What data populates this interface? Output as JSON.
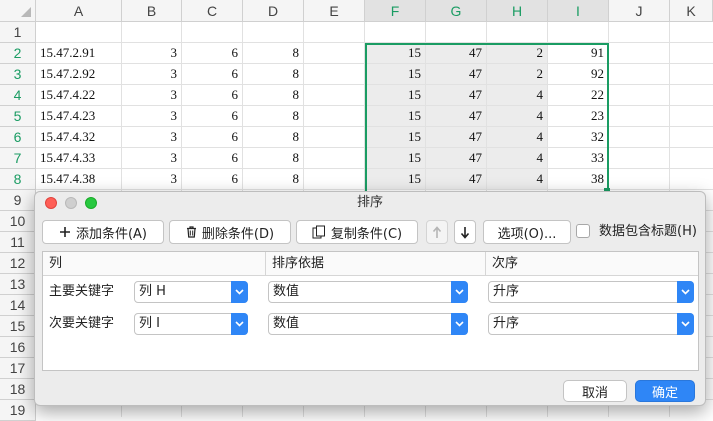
{
  "sheet": {
    "columns": [
      "A",
      "B",
      "C",
      "D",
      "E",
      "F",
      "G",
      "H",
      "I",
      "J",
      "K"
    ],
    "rows": [
      "1",
      "2",
      "3",
      "4",
      "5",
      "6",
      "7",
      "8",
      "9",
      "10",
      "11",
      "12",
      "13",
      "14",
      "15",
      "16",
      "17",
      "18",
      "19"
    ],
    "data": [
      [
        "15.47.2.91",
        "3",
        "6",
        "8",
        "15",
        "47",
        "2",
        "91"
      ],
      [
        "15.47.2.92",
        "3",
        "6",
        "8",
        "15",
        "47",
        "2",
        "92"
      ],
      [
        "15.47.4.22",
        "3",
        "6",
        "8",
        "15",
        "47",
        "4",
        "22"
      ],
      [
        "15.47.4.23",
        "3",
        "6",
        "8",
        "15",
        "47",
        "4",
        "23"
      ],
      [
        "15.47.4.32",
        "3",
        "6",
        "8",
        "15",
        "47",
        "4",
        "32"
      ],
      [
        "15.47.4.33",
        "3",
        "6",
        "8",
        "15",
        "47",
        "4",
        "33"
      ],
      [
        "15.47.4.38",
        "3",
        "6",
        "8",
        "15",
        "47",
        "4",
        "38"
      ]
    ],
    "selection_color": "#1a9c63"
  },
  "dialog": {
    "title": "排序",
    "toolbar": {
      "add_condition": "添加条件(A)",
      "delete_condition": "删除条件(D)",
      "copy_condition": "复制条件(C)",
      "move_up_icon": "arrow-up-icon",
      "move_down_icon": "arrow-down-icon",
      "options": "选项(O)...",
      "header_checkbox_label": "数据包含标题(H)",
      "header_checkbox_checked": false
    },
    "table": {
      "headers": {
        "column": "列",
        "sort_on": "排序依据",
        "order": "次序"
      },
      "rows": [
        {
          "label": "主要关键字",
          "column": "列 H",
          "sort_on": "数值",
          "order": "升序"
        },
        {
          "label": "次要关键字",
          "column": "列 I",
          "sort_on": "数值",
          "order": "升序"
        }
      ]
    },
    "buttons": {
      "cancel": "取消",
      "ok": "确定"
    },
    "accent_color": "#2f86f6"
  }
}
